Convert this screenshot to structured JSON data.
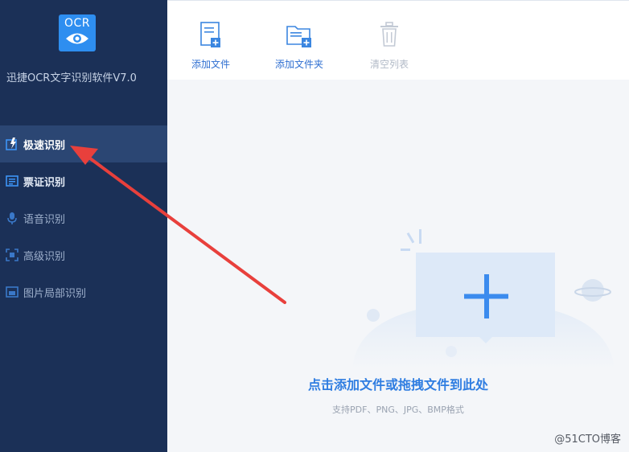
{
  "app": {
    "logo_text": "OCR",
    "title": "迅捷OCR文字识别软件V7.0"
  },
  "sidebar": {
    "items": [
      {
        "label": "极速识别",
        "icon": "fast-recognition-icon"
      },
      {
        "label": "票证识别",
        "icon": "ticket-recognition-icon"
      },
      {
        "label": "语音识别",
        "icon": "microphone-icon"
      },
      {
        "label": "高级识别",
        "icon": "advanced-scan-icon"
      },
      {
        "label": "图片局部识别",
        "icon": "image-partial-icon"
      }
    ]
  },
  "toolbar": {
    "add_file": "添加文件",
    "add_folder": "添加文件夹",
    "clear_list": "清空列表"
  },
  "dropzone": {
    "title": "点击添加文件或拖拽文件到此处",
    "subtitle": "支持PDF、PNG、JPG、BMP格式"
  },
  "watermark": "@51CTO博客",
  "colors": {
    "sidebar_bg": "#1b3057",
    "sidebar_active": "#2b4673",
    "accent": "#2f7de1",
    "annotation_arrow": "#e8403c"
  }
}
